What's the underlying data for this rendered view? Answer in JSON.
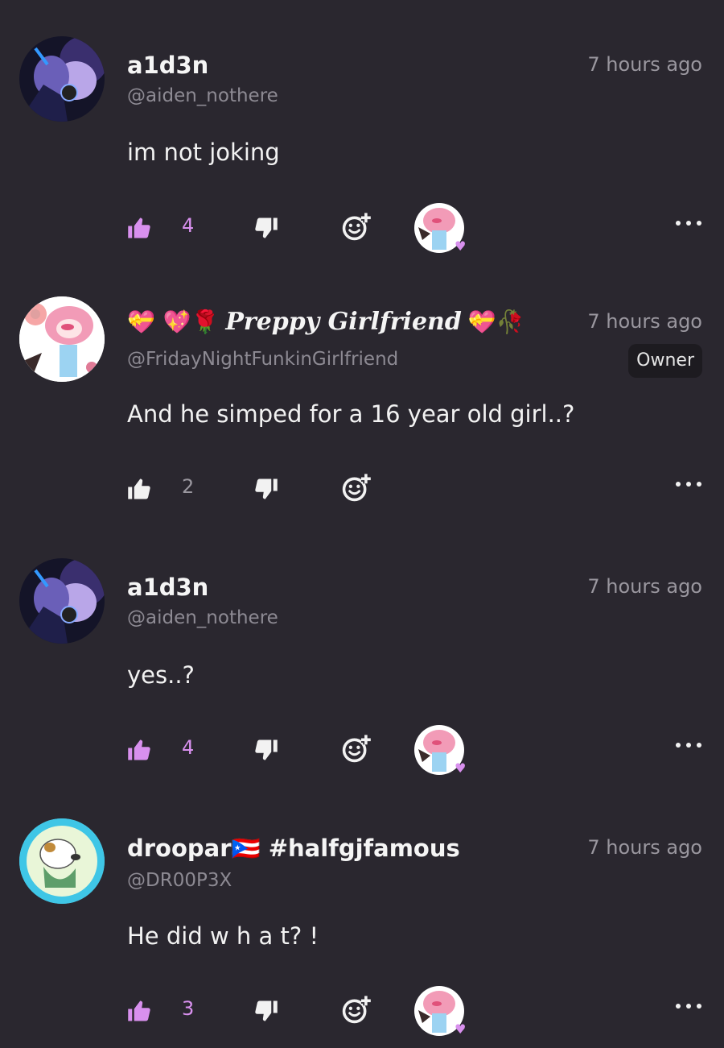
{
  "comments": [
    {
      "name": "a1d3n",
      "handle": "@aiden_nothere",
      "time": "7 hours ago",
      "text": "im not joking",
      "likes": "4",
      "liked": true
    },
    {
      "name_prefix": "💝 💖🌹",
      "name_fancy": "Preppy Girlfriend",
      "name_suffix": "💝🥀",
      "handle": "@FridayNightFunkinGirlfriend",
      "time": "7 hours ago",
      "badge": "Owner",
      "text": "And he simped for a 16 year old girl..?",
      "likes": "2",
      "liked": false
    },
    {
      "name": "a1d3n",
      "handle": "@aiden_nothere",
      "time": "7 hours ago",
      "text": "yes..?",
      "likes": "4",
      "liked": true
    },
    {
      "name": "droopar🇵🇷 #halfgjfamous",
      "handle": "@DR00P3X",
      "time": "7 hours ago",
      "text": "He did  w h a t? !",
      "likes": "3",
      "liked": true
    }
  ],
  "colors": {
    "background": "#2a272f",
    "liked_accent": "#d890ee",
    "muted_text": "#8d8a93"
  },
  "icons": {
    "like": "thumbs-up-icon",
    "dislike": "thumbs-down-icon",
    "react": "add-reaction-icon",
    "more": "more-options-icon",
    "reacted": "heart-icon"
  }
}
